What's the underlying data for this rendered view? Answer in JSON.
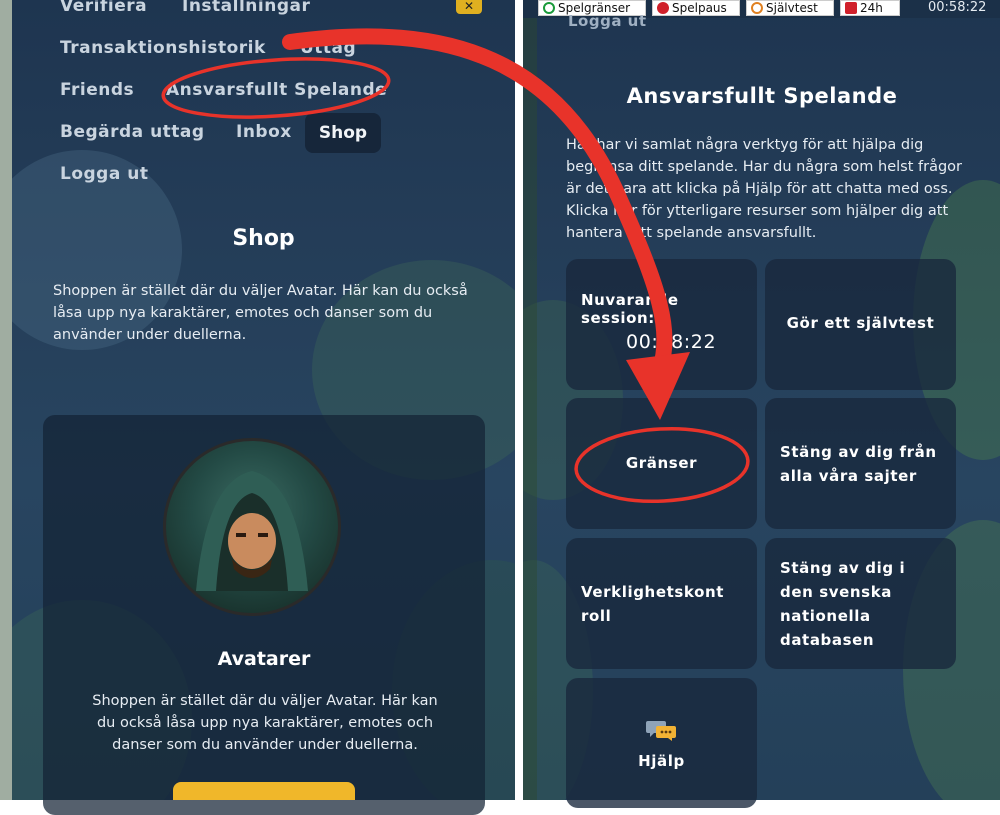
{
  "left": {
    "nav": {
      "verifiera": "Verifiera",
      "installningar": "Inställningar",
      "transaktionshistorik": "Transaktionshistorik",
      "uttag": "Uttag",
      "friends": "Friends",
      "ansvarsfullt": "Ansvarsfullt Spelande",
      "begarda_uttag": "Begärda uttag",
      "inbox": "Inbox",
      "shop": "Shop",
      "logga_ut": "Logga ut"
    },
    "section_title": "Shop",
    "section_text": "Shoppen är stället där du väljer Avatar. Här kan du också låsa upp nya karaktärer, emotes och danser som du använder under duellerna.",
    "card_title": "Avatarer",
    "card_text": "Shoppen är stället där du väljer Avatar. Här kan du också låsa upp nya karaktärer, emotes och danser som du använder under duellerna."
  },
  "right": {
    "topbar": {
      "spelgranser": "Spelgränser",
      "spelpaus": "Spelpaus",
      "sjalvtest": "Självtest",
      "limit": "24h",
      "clock": "00:58:22"
    },
    "logga_ut_partial": "Logga ut",
    "title": "Ansvarsfullt Spelande",
    "intro": "Här har vi samlat några verktyg för att hjälpa dig begränsa ditt spelande. Har du några som helst frågor är det bara att klicka på Hjälp för att chatta med oss. Klicka här för ytterligare resurser som hjälper dig att hantera ditt spelande ansvarsfullt.",
    "tiles": {
      "session_label": "Nuvarande session:",
      "session_time": "00:58:22",
      "sjalvtest": "Gör ett självtest",
      "granser": "Gränser",
      "stang_alla": "Stäng av dig från alla våra sajter",
      "verklighet": "Verklighetskontroll",
      "stang_svenska": "Stäng av dig i den svenska nationella databasen",
      "hjalp": "Hjälp"
    }
  },
  "colors": {
    "accent_red": "#e8332a",
    "panel_bg": "#243d58",
    "tile_bg": "#18283c",
    "button_yellow": "#f0b72a"
  },
  "icons": [
    "close-icon",
    "spelgranser-icon",
    "spelpaus-icon",
    "sjalvtest-icon",
    "stop-icon",
    "chat-bubble-icon",
    "avatar-image"
  ]
}
